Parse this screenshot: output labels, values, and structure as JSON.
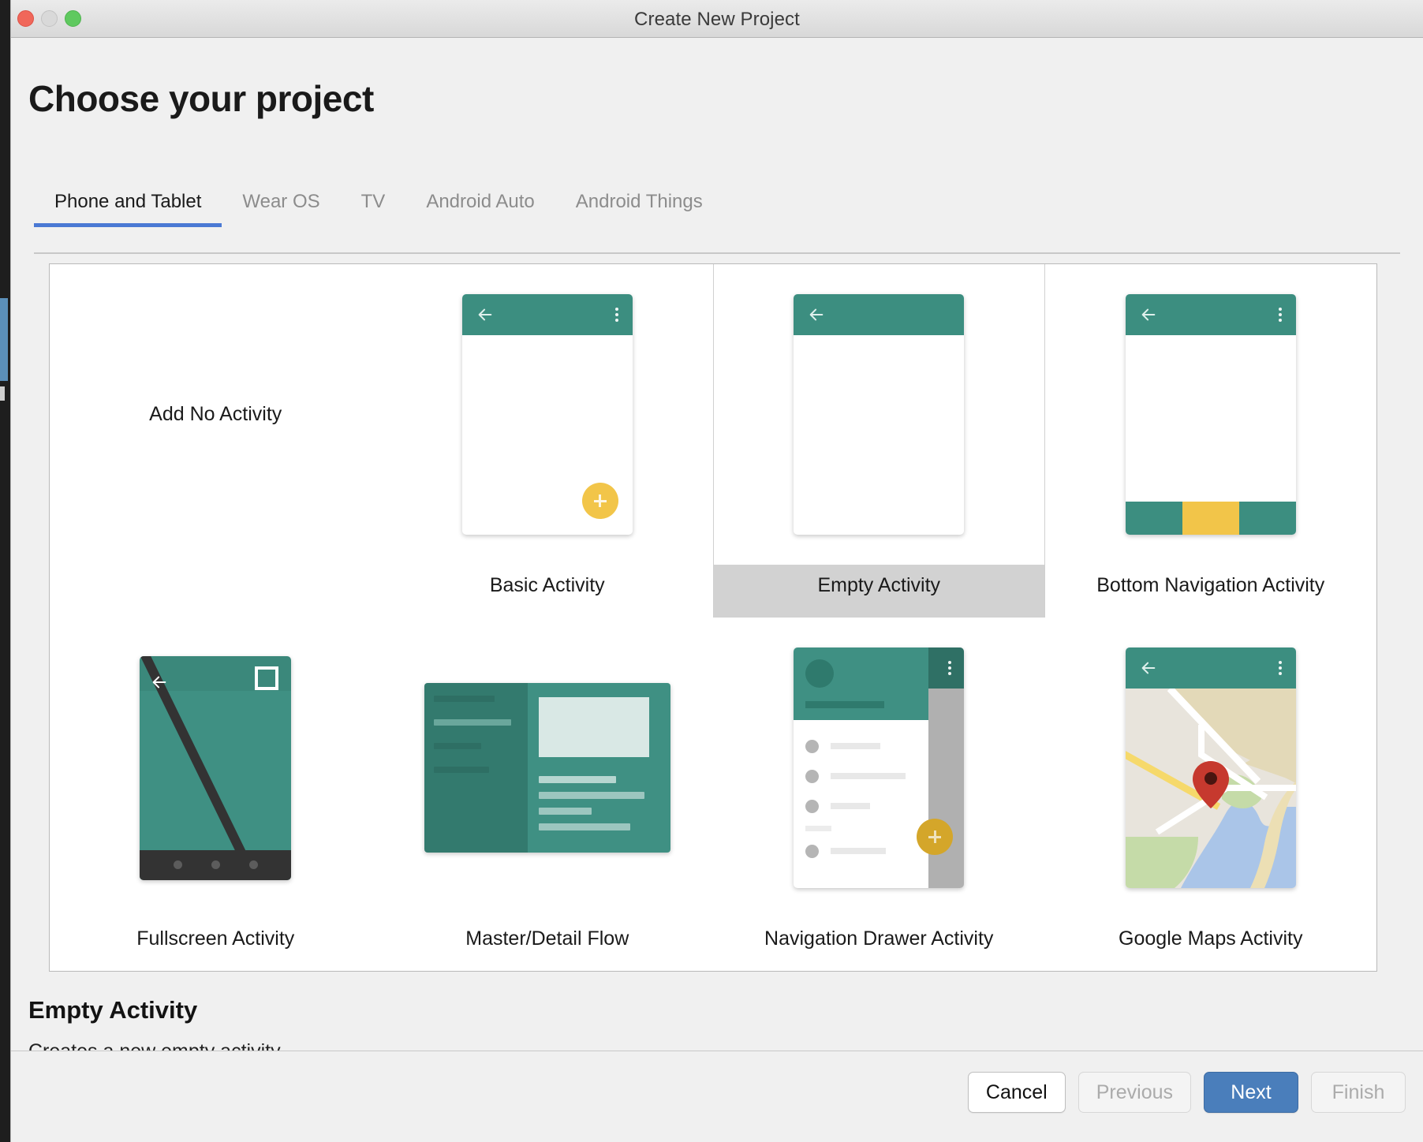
{
  "window": {
    "title": "Create New Project",
    "traffic_lights": [
      "close-red",
      "minimize-yellow",
      "zoom-green"
    ]
  },
  "page": {
    "heading": "Choose your project"
  },
  "tabs": [
    {
      "label": "Phone and Tablet",
      "active": true
    },
    {
      "label": "Wear OS",
      "active": false
    },
    {
      "label": "TV",
      "active": false
    },
    {
      "label": "Android Auto",
      "active": false
    },
    {
      "label": "Android Things",
      "active": false
    }
  ],
  "templates": [
    {
      "label": "Add No Activity",
      "kind": "text-only",
      "selected": false
    },
    {
      "label": "Basic Activity",
      "kind": "basic",
      "selected": false
    },
    {
      "label": "Empty Activity",
      "kind": "empty",
      "selected": true
    },
    {
      "label": "Bottom Navigation Activity",
      "kind": "bottom-nav",
      "selected": false
    },
    {
      "label": "Fullscreen Activity",
      "kind": "fullscreen",
      "selected": false
    },
    {
      "label": "Master/Detail Flow",
      "kind": "master-detail",
      "selected": false
    },
    {
      "label": "Navigation Drawer Activity",
      "kind": "nav-drawer",
      "selected": false
    },
    {
      "label": "Google Maps Activity",
      "kind": "google-maps",
      "selected": false
    }
  ],
  "description": {
    "title": "Empty Activity",
    "text": "Creates a new empty activity"
  },
  "footer": {
    "buttons": [
      {
        "label": "Cancel",
        "state": "enabled"
      },
      {
        "label": "Previous",
        "state": "disabled"
      },
      {
        "label": "Next",
        "state": "primary"
      },
      {
        "label": "Finish",
        "state": "disabled"
      }
    ]
  },
  "colors": {
    "accent_blue": "#4a79d4",
    "primary_button": "#4a7ebb",
    "teal": "#3f9083",
    "teal_dark": "#337a6e",
    "amber": "#f2c549",
    "selection_gray": "#d2d2d2",
    "map_land": "#e8e4dc",
    "map_water": "#aac5e8",
    "map_green": "#c5dba8",
    "map_sand": "#e3d9b8",
    "map_pin": "#c6392e"
  }
}
